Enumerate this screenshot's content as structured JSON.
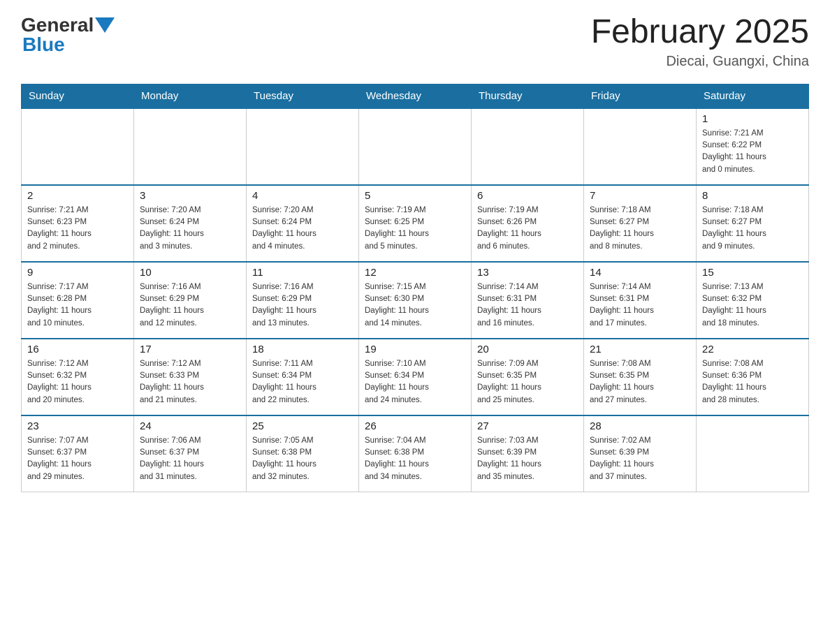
{
  "header": {
    "logo_general": "General",
    "logo_blue": "Blue",
    "month_title": "February 2025",
    "location": "Diecai, Guangxi, China"
  },
  "weekdays": [
    "Sunday",
    "Monday",
    "Tuesday",
    "Wednesday",
    "Thursday",
    "Friday",
    "Saturday"
  ],
  "weeks": [
    [
      {
        "day": "",
        "info": ""
      },
      {
        "day": "",
        "info": ""
      },
      {
        "day": "",
        "info": ""
      },
      {
        "day": "",
        "info": ""
      },
      {
        "day": "",
        "info": ""
      },
      {
        "day": "",
        "info": ""
      },
      {
        "day": "1",
        "info": "Sunrise: 7:21 AM\nSunset: 6:22 PM\nDaylight: 11 hours\nand 0 minutes."
      }
    ],
    [
      {
        "day": "2",
        "info": "Sunrise: 7:21 AM\nSunset: 6:23 PM\nDaylight: 11 hours\nand 2 minutes."
      },
      {
        "day": "3",
        "info": "Sunrise: 7:20 AM\nSunset: 6:24 PM\nDaylight: 11 hours\nand 3 minutes."
      },
      {
        "day": "4",
        "info": "Sunrise: 7:20 AM\nSunset: 6:24 PM\nDaylight: 11 hours\nand 4 minutes."
      },
      {
        "day": "5",
        "info": "Sunrise: 7:19 AM\nSunset: 6:25 PM\nDaylight: 11 hours\nand 5 minutes."
      },
      {
        "day": "6",
        "info": "Sunrise: 7:19 AM\nSunset: 6:26 PM\nDaylight: 11 hours\nand 6 minutes."
      },
      {
        "day": "7",
        "info": "Sunrise: 7:18 AM\nSunset: 6:27 PM\nDaylight: 11 hours\nand 8 minutes."
      },
      {
        "day": "8",
        "info": "Sunrise: 7:18 AM\nSunset: 6:27 PM\nDaylight: 11 hours\nand 9 minutes."
      }
    ],
    [
      {
        "day": "9",
        "info": "Sunrise: 7:17 AM\nSunset: 6:28 PM\nDaylight: 11 hours\nand 10 minutes."
      },
      {
        "day": "10",
        "info": "Sunrise: 7:16 AM\nSunset: 6:29 PM\nDaylight: 11 hours\nand 12 minutes."
      },
      {
        "day": "11",
        "info": "Sunrise: 7:16 AM\nSunset: 6:29 PM\nDaylight: 11 hours\nand 13 minutes."
      },
      {
        "day": "12",
        "info": "Sunrise: 7:15 AM\nSunset: 6:30 PM\nDaylight: 11 hours\nand 14 minutes."
      },
      {
        "day": "13",
        "info": "Sunrise: 7:14 AM\nSunset: 6:31 PM\nDaylight: 11 hours\nand 16 minutes."
      },
      {
        "day": "14",
        "info": "Sunrise: 7:14 AM\nSunset: 6:31 PM\nDaylight: 11 hours\nand 17 minutes."
      },
      {
        "day": "15",
        "info": "Sunrise: 7:13 AM\nSunset: 6:32 PM\nDaylight: 11 hours\nand 18 minutes."
      }
    ],
    [
      {
        "day": "16",
        "info": "Sunrise: 7:12 AM\nSunset: 6:32 PM\nDaylight: 11 hours\nand 20 minutes."
      },
      {
        "day": "17",
        "info": "Sunrise: 7:12 AM\nSunset: 6:33 PM\nDaylight: 11 hours\nand 21 minutes."
      },
      {
        "day": "18",
        "info": "Sunrise: 7:11 AM\nSunset: 6:34 PM\nDaylight: 11 hours\nand 22 minutes."
      },
      {
        "day": "19",
        "info": "Sunrise: 7:10 AM\nSunset: 6:34 PM\nDaylight: 11 hours\nand 24 minutes."
      },
      {
        "day": "20",
        "info": "Sunrise: 7:09 AM\nSunset: 6:35 PM\nDaylight: 11 hours\nand 25 minutes."
      },
      {
        "day": "21",
        "info": "Sunrise: 7:08 AM\nSunset: 6:35 PM\nDaylight: 11 hours\nand 27 minutes."
      },
      {
        "day": "22",
        "info": "Sunrise: 7:08 AM\nSunset: 6:36 PM\nDaylight: 11 hours\nand 28 minutes."
      }
    ],
    [
      {
        "day": "23",
        "info": "Sunrise: 7:07 AM\nSunset: 6:37 PM\nDaylight: 11 hours\nand 29 minutes."
      },
      {
        "day": "24",
        "info": "Sunrise: 7:06 AM\nSunset: 6:37 PM\nDaylight: 11 hours\nand 31 minutes."
      },
      {
        "day": "25",
        "info": "Sunrise: 7:05 AM\nSunset: 6:38 PM\nDaylight: 11 hours\nand 32 minutes."
      },
      {
        "day": "26",
        "info": "Sunrise: 7:04 AM\nSunset: 6:38 PM\nDaylight: 11 hours\nand 34 minutes."
      },
      {
        "day": "27",
        "info": "Sunrise: 7:03 AM\nSunset: 6:39 PM\nDaylight: 11 hours\nand 35 minutes."
      },
      {
        "day": "28",
        "info": "Sunrise: 7:02 AM\nSunset: 6:39 PM\nDaylight: 11 hours\nand 37 minutes."
      },
      {
        "day": "",
        "info": ""
      }
    ]
  ]
}
